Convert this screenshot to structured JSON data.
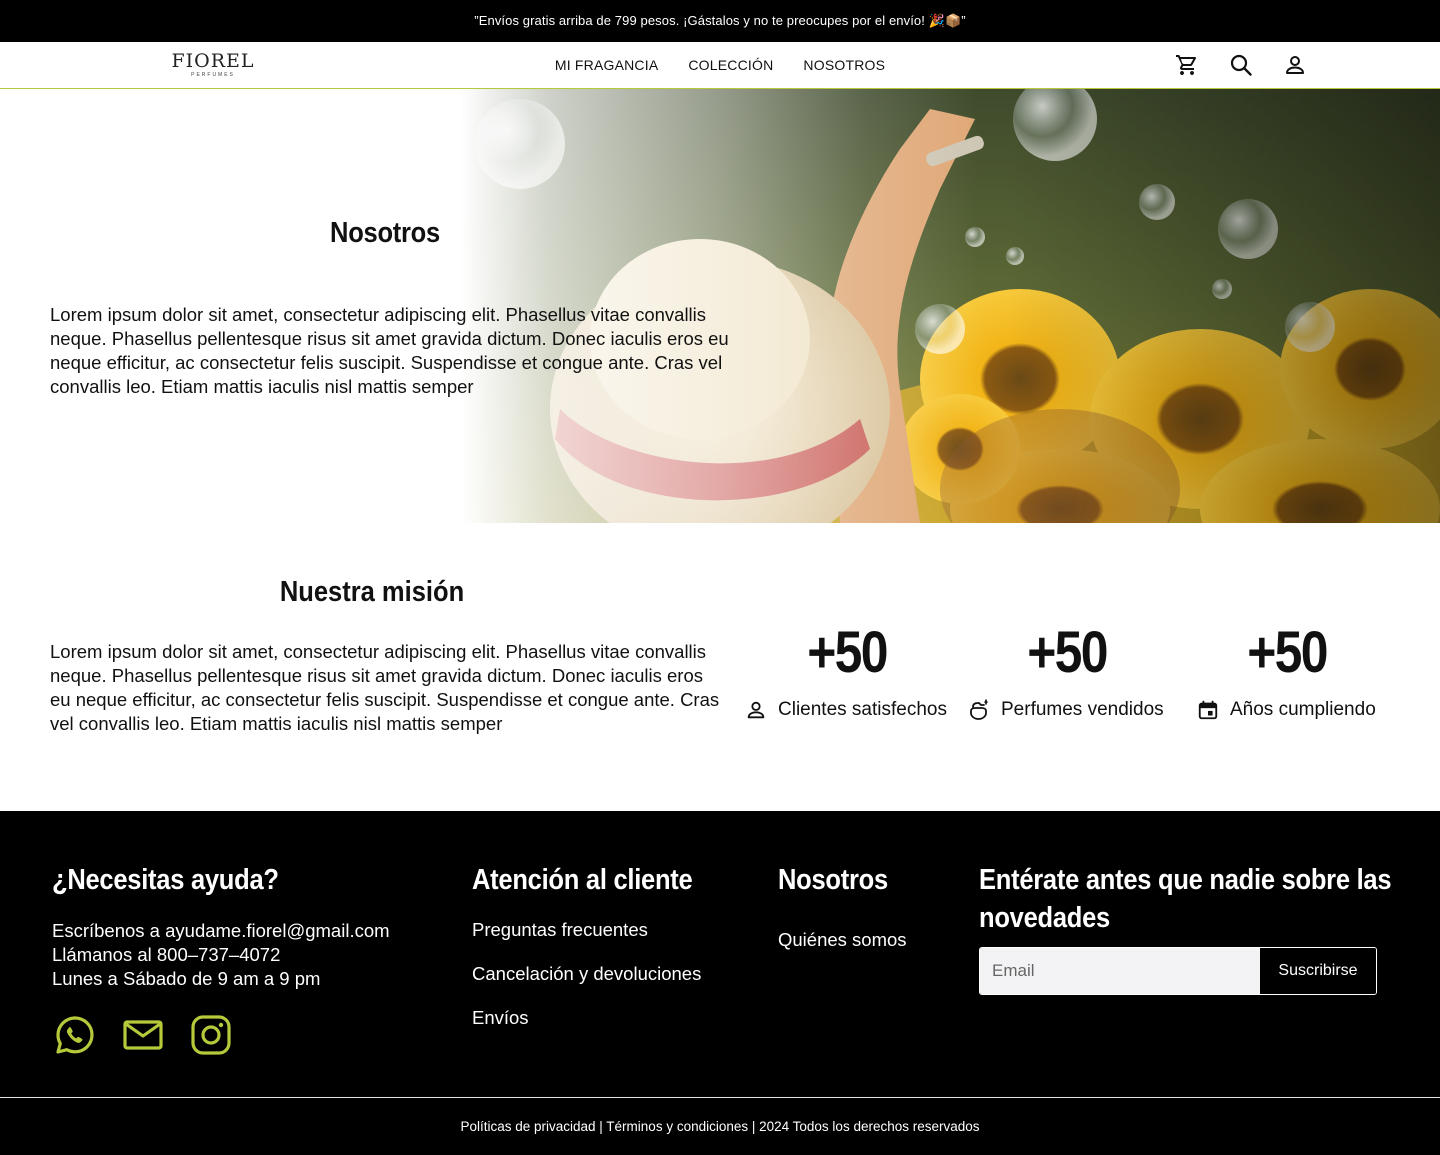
{
  "announcement": {
    "text": "”Envíos gratis arriba de 799 pesos. ¡Gástalos y no te preocupes por el envío! 🎉📦”"
  },
  "header": {
    "logo_text": "FIOREL",
    "logo_sub": "PERFUMES",
    "nav": [
      "MI FRAGANCIA",
      "COLECCIÓN",
      "NOSOTROS"
    ],
    "icons": [
      "cart-icon",
      "search-icon",
      "user-icon"
    ]
  },
  "hero": {
    "title": "Nosotros",
    "text": "Lorem ipsum dolor sit amet, consectetur adipiscing elit. Phasellus vitae convallis neque. Phasellus pellentesque risus sit amet gravida dictum. Donec iaculis eros eu neque efficitur, ac consectetur felis suscipit. Suspendisse et congue ante. Cras vel convallis leo. Etiam mattis iaculis nisl mattis semper"
  },
  "mission": {
    "title": "Nuestra misión",
    "text": "Lorem ipsum dolor sit amet, consectetur adipiscing elit. Phasellus vitae convallis neque. Phasellus pellentesque risus sit amet gravida dictum. Donec iaculis eros eu neque efficitur, ac consectetur felis suscipit. Suspendisse et congue ante. Cras vel convallis leo. Etiam mattis iaculis nisl mattis semper",
    "stats": [
      {
        "value": "+50",
        "label": "Clientes satisfechos",
        "icon": "person-icon"
      },
      {
        "value": "+50",
        "label": "Perfumes vendidos",
        "icon": "perfume-spray-icon"
      },
      {
        "value": "+50",
        "label": "Años cumpliendo",
        "icon": "calendar-icon"
      }
    ]
  },
  "footer": {
    "help": {
      "title": "¿Necesitas ayuda?",
      "lines": [
        "Escríbenos a ayudame.fiorel@gmail.com",
        "Llámanos al 800–737–4072",
        "Lunes a Sábado de 9 am a 9 pm"
      ],
      "social": [
        "whatsapp-icon",
        "mail-icon",
        "instagram-icon"
      ]
    },
    "customer": {
      "title": "Atención al cliente",
      "links": [
        "Preguntas frecuentes",
        "Cancelación y devoluciones",
        "Envíos"
      ]
    },
    "about": {
      "title": "Nosotros",
      "links": [
        "Quiénes somos"
      ]
    },
    "newsletter": {
      "title_line1": "Entérate antes que nadie sobre las",
      "title_line2": "novedades",
      "placeholder": "Email",
      "button": "Suscribirse"
    },
    "bottom": "Políticas de privacidad | Términos y condiciones | 2024 Todos los derechos reservados"
  },
  "colors": {
    "accent": "#b5c93a",
    "footer_bg": "#000000",
    "text": "#111111"
  }
}
